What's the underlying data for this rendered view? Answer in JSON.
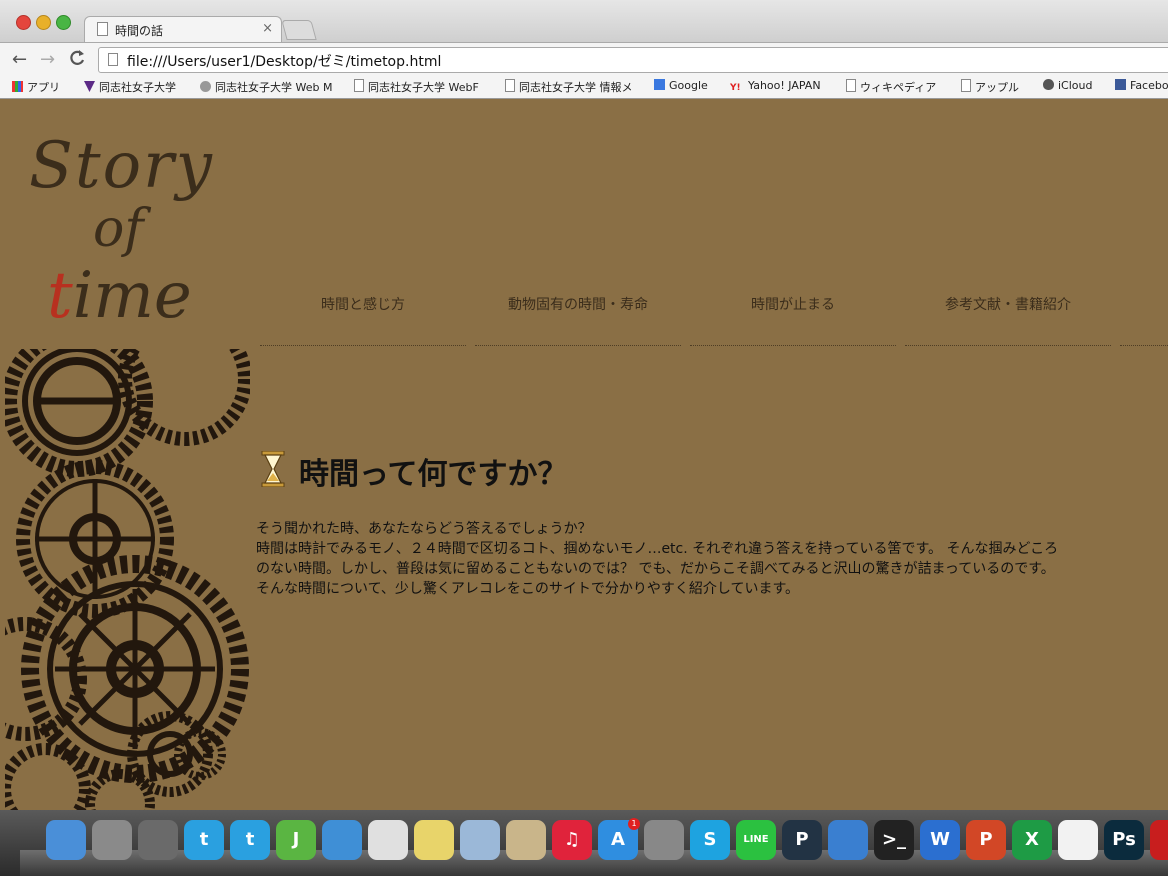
{
  "browser": {
    "tab_title": "時間の話",
    "tab_close": "×",
    "url": "file:///Users/user1/Desktop/ゼミ/timetop.html",
    "nav": {
      "back": "←",
      "forward": "→",
      "reload": "C"
    },
    "bookmarks": [
      {
        "label": "アプリ",
        "icon": "apps-grid-icon"
      },
      {
        "label": "同志社女子大学",
        "icon": "university-icon"
      },
      {
        "label": "同志社女子大学 Web M",
        "icon": "web-icon"
      },
      {
        "label": "同志社女子大学 WebF",
        "icon": "page-icon"
      },
      {
        "label": "同志社女子大学 情報メ",
        "icon": "page-icon"
      },
      {
        "label": "Google",
        "icon": "google-icon"
      },
      {
        "label": "Yahoo! JAPAN",
        "icon": "yahoo-icon"
      },
      {
        "label": "ウィキペディア",
        "icon": "page-icon"
      },
      {
        "label": "アップル",
        "icon": "page-icon"
      },
      {
        "label": "iCloud",
        "icon": "apple-icon"
      },
      {
        "label": "Facebo",
        "icon": "facebook-icon"
      }
    ]
  },
  "site": {
    "logo": {
      "line1": "Story",
      "line2": "of",
      "line3_t": "t",
      "line3_rest": "ime"
    },
    "menu": [
      "時間と感じ方",
      "動物固有の時間・寿命",
      "時間が止まる",
      "参考文献・書籍紹介"
    ],
    "heading": "時間って何ですか？",
    "paragraphs": [
      "そう聞かれた時、あなたならどう答えるでしょうか？",
      "時間は時計でみるモノ、２４時間で区切るコト、掴めないモノ…etc. それぞれ違う答えを持っている筈です。 そんな掴みどころ",
      "のない時間。しかし、普段は気に留めることもないのでは？ でも、だからこそ調べてみると沢山の驚きが詰まっているのです。",
      "そんな時間について、少し驚くアレコレをこのサイトで分かりやすく紹介しています。"
    ],
    "colors": {
      "background": "#8a6f45",
      "logo_dark": "#3b2d1b",
      "logo_accent": "#b8301f"
    }
  },
  "dock": {
    "apps": [
      {
        "name": "finder-icon",
        "glyph": "",
        "color": "#4a8fd8"
      },
      {
        "name": "launchpad-icon",
        "glyph": "",
        "color": "#8a8a8a"
      },
      {
        "name": "photo-icon",
        "glyph": "",
        "color": "#6a6a6a"
      },
      {
        "name": "twitter-icon",
        "glyph": "t",
        "color": "#2aa0e0"
      },
      {
        "name": "twitter-icon-2",
        "glyph": "t",
        "color": "#2aa0e0"
      },
      {
        "name": "j-app-icon",
        "glyph": "J",
        "color": "#5ab542"
      },
      {
        "name": "safari-icon",
        "glyph": "",
        "color": "#3f8fd6"
      },
      {
        "name": "chrome-icon",
        "glyph": "",
        "color": "#e0e0e0"
      },
      {
        "name": "stickies-icon",
        "glyph": "",
        "color": "#e8d46a"
      },
      {
        "name": "preview-icon",
        "glyph": "",
        "color": "#9bb8d8"
      },
      {
        "name": "mail-icon",
        "glyph": "",
        "color": "#c9b58a"
      },
      {
        "name": "itunes-icon",
        "glyph": "♫",
        "color": "#e0233b"
      },
      {
        "name": "app-store-icon",
        "glyph": "A",
        "color": "#2f8ee0"
      },
      {
        "name": "system-preferences-icon",
        "glyph": "",
        "color": "#888"
      },
      {
        "name": "skype-icon",
        "glyph": "S",
        "color": "#1ea3e0"
      },
      {
        "name": "line-icon",
        "glyph": "LINE",
        "color": "#2bc140"
      },
      {
        "name": "p-app-icon",
        "glyph": "P",
        "color": "#223344"
      },
      {
        "name": "xcode-icon",
        "glyph": "",
        "color": "#3a7fd0"
      },
      {
        "name": "terminal-icon",
        "glyph": ">_",
        "color": "#222"
      },
      {
        "name": "word-icon",
        "glyph": "W",
        "color": "#2b6fd0"
      },
      {
        "name": "powerpoint-icon",
        "glyph": "P",
        "color": "#d24726"
      },
      {
        "name": "excel-icon",
        "glyph": "X",
        "color": "#1e9b45"
      },
      {
        "name": "alpaca-icon",
        "glyph": "",
        "color": "#f2f2f2"
      },
      {
        "name": "photoshop-icon",
        "glyph": "Ps",
        "color": "#0b2b3d"
      },
      {
        "name": "acrobat-icon",
        "glyph": "",
        "color": "#c81e1e"
      }
    ],
    "app_store_badge": "1"
  }
}
